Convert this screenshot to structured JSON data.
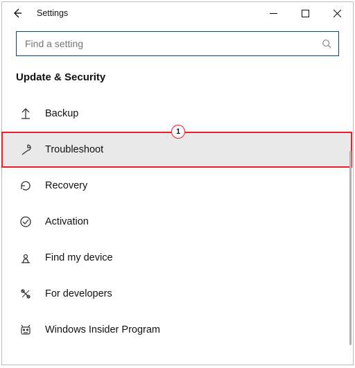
{
  "window": {
    "title": "Settings"
  },
  "search": {
    "placeholder": "Find a setting"
  },
  "section": {
    "title": "Update & Security"
  },
  "items": [
    {
      "label": "Backup",
      "icon": "backup"
    },
    {
      "label": "Troubleshoot",
      "icon": "troubleshoot"
    },
    {
      "label": "Recovery",
      "icon": "recovery"
    },
    {
      "label": "Activation",
      "icon": "activation"
    },
    {
      "label": "Find my device",
      "icon": "find-device"
    },
    {
      "label": "For developers",
      "icon": "developers"
    },
    {
      "label": "Windows Insider Program",
      "icon": "insider"
    }
  ],
  "annotation": {
    "highlighted_index": 1,
    "callout_number": "1"
  }
}
